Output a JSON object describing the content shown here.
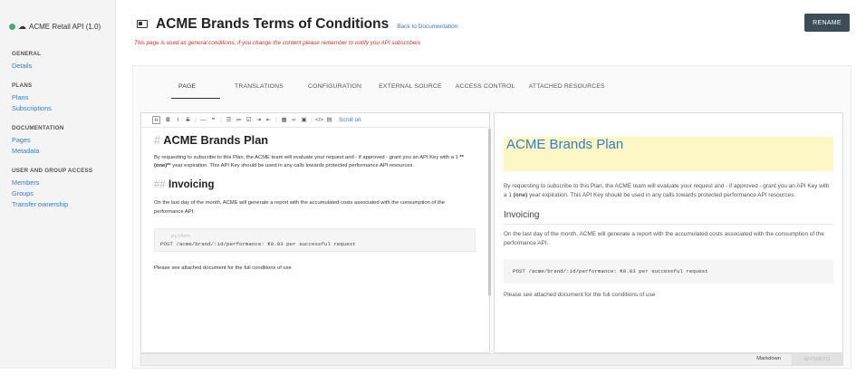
{
  "sidebar": {
    "api_title": "ACME Retail API (1.0)",
    "sections": [
      {
        "heading": "GENERAL",
        "links": [
          "Details"
        ]
      },
      {
        "heading": "PLANS",
        "links": [
          "Plans",
          "Subscriptions"
        ]
      },
      {
        "heading": "DOCUMENTATION",
        "links": [
          "Pages",
          "Metadata"
        ]
      },
      {
        "heading": "USER AND GROUP ACCESS",
        "links": [
          "Members",
          "Groups",
          "Transfer ownership"
        ]
      }
    ]
  },
  "header": {
    "title": "ACME Brands Terms of Conditions",
    "back_link": "Back to Documentation",
    "warning": "This page is used as general conditions, if you change the content please remember to notify you API subscribers",
    "rename_label": "RENAME"
  },
  "tabs": [
    "PAGE",
    "TRANSLATIONS",
    "CONFIGURATION",
    "EXTERNAL SOURCE",
    "ACCESS CONTROL",
    "ATTACHED RESOURCES"
  ],
  "toolbar": {
    "scroll_label": "Scroll on"
  },
  "editor": {
    "h1_marker": "#",
    "h1": "ACME Brands Plan",
    "p1_before": "By requesting to subscribe to this Plan, the ACME team will evaluate your request and - if approved - grant you an API Key with a 1 ",
    "p1_bold": "**(one)**",
    "p1_after": " year expiration. This API Key should be used in any calls towards protected performance API resources.",
    "h2_marker": "##",
    "h2": "Invoicing",
    "p2": "On the last day of the month, ACME will generate a report with the accumulated costs associated with the consumption of the performance API.",
    "code_lang": "python",
    "code": "POST /acme/brand/:id/performance: €0.03 per successful request",
    "p3": "Please see attached document for the full conditions of use"
  },
  "preview": {
    "h1": "ACME Brands Plan",
    "p1_before": "By requesting to subscribe to this Plan, the ACME team will evaluate your request and - if approved - grant you an API Key with a 1 ",
    "p1_bold": "(one)",
    "p1_after": " year expiration. This API Key should be used in any calls towards protected performance API resources.",
    "h2": "Invoicing",
    "p2": "On the last day of the month, ACME will generate a report with the accumulated costs associated with the consumption of the performance API.",
    "code": "POST /acme/brand/:id/performance: €0.03 per successful request",
    "p3": "Please see attached document for the full conditions of use"
  },
  "bottom_bar": {
    "mode_markdown": "Markdown",
    "mode_wysiwyg": "WYSIWYG"
  },
  "colors": {
    "accent_link": "#3b7cc4",
    "warning": "#d0352b",
    "rename_button": "#3c4c59",
    "preview_title_bg": "#fdf6c5"
  }
}
